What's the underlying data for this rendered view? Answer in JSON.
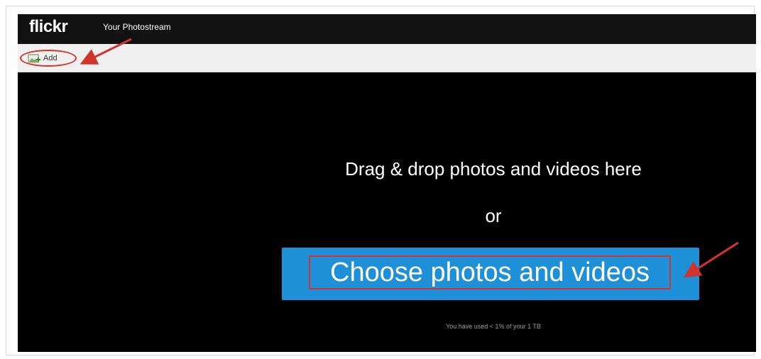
{
  "header": {
    "logo": "flickr",
    "title": "Your Photostream"
  },
  "toolbar": {
    "add_label": "Add"
  },
  "upload": {
    "drag_text": "Drag & drop photos and videos here",
    "or_text": "or",
    "choose_label": "Choose photos and videos",
    "usage_text": "You have used < 1% of your 1 TB"
  },
  "colors": {
    "topbar": "#111111",
    "dropzone": "#000000",
    "button": "#1e90d8",
    "annotation": "#d0342c"
  }
}
